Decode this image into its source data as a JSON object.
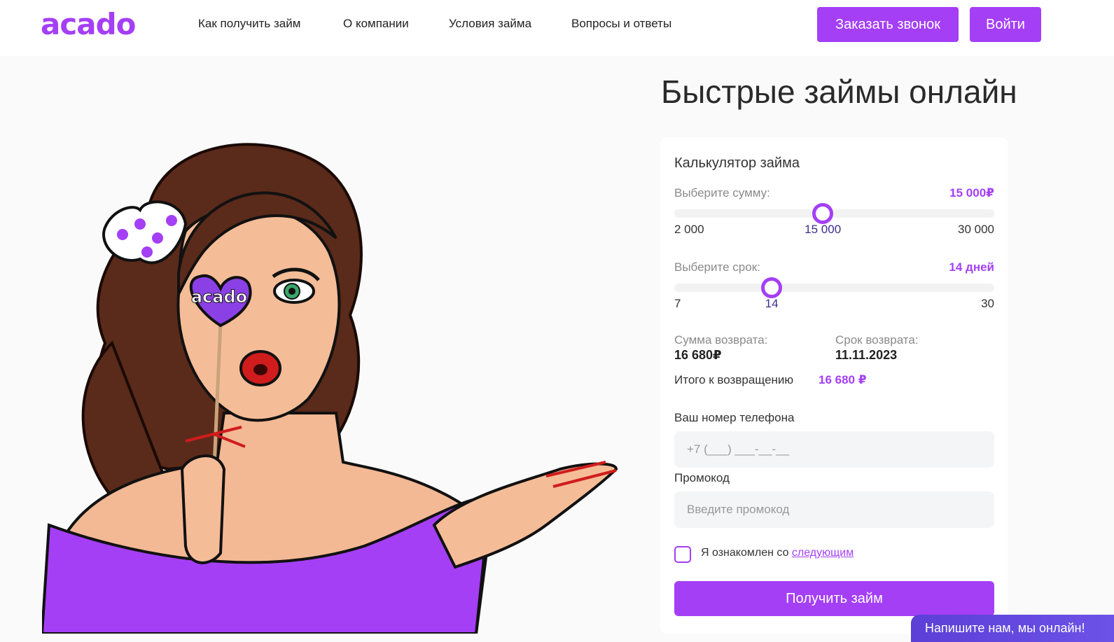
{
  "header": {
    "logo": "acado",
    "nav": [
      "Как получить займ",
      "О компании",
      "Условия займа",
      "Вопросы и ответы"
    ],
    "call_button": "Заказать звонок",
    "login_button": "Войти"
  },
  "hero": {
    "title": "Быстрые займы онлайн",
    "illustration_badge": "acado"
  },
  "calculator": {
    "title": "Калькулятор займа",
    "amount": {
      "label": "Выберите сумму:",
      "value_text": "15 000₽",
      "min_label": "2 000",
      "current_label": "15 000",
      "max_label": "30 000",
      "min": 2000,
      "max": 30000,
      "value": 15000
    },
    "term": {
      "label": "Выберите срок:",
      "value_text": "14 дней",
      "min_label": "7",
      "current_label": "14",
      "max_label": "30",
      "min": 7,
      "max": 30,
      "value": 14
    },
    "return_sum_label": "Сумма возврата:",
    "return_sum_value": "16 680₽",
    "return_date_label": "Срок возврата:",
    "return_date_value": "11.11.2023",
    "total_label": "Итого к возвращению",
    "total_value": "16 680 ₽",
    "phone_label": "Ваш номер телефона",
    "phone_placeholder": "+7 (___) ___-__-__",
    "promo_label": "Промокод",
    "promo_placeholder": "Введите промокод",
    "agree_text": "Я ознакомлен со",
    "agree_link": "следующим",
    "submit_button": "Получить займ"
  },
  "chat": {
    "text": "Напишите нам, мы онлайн!"
  },
  "colors": {
    "accent": "#a43ff6",
    "chat": "#5b3fd6"
  }
}
